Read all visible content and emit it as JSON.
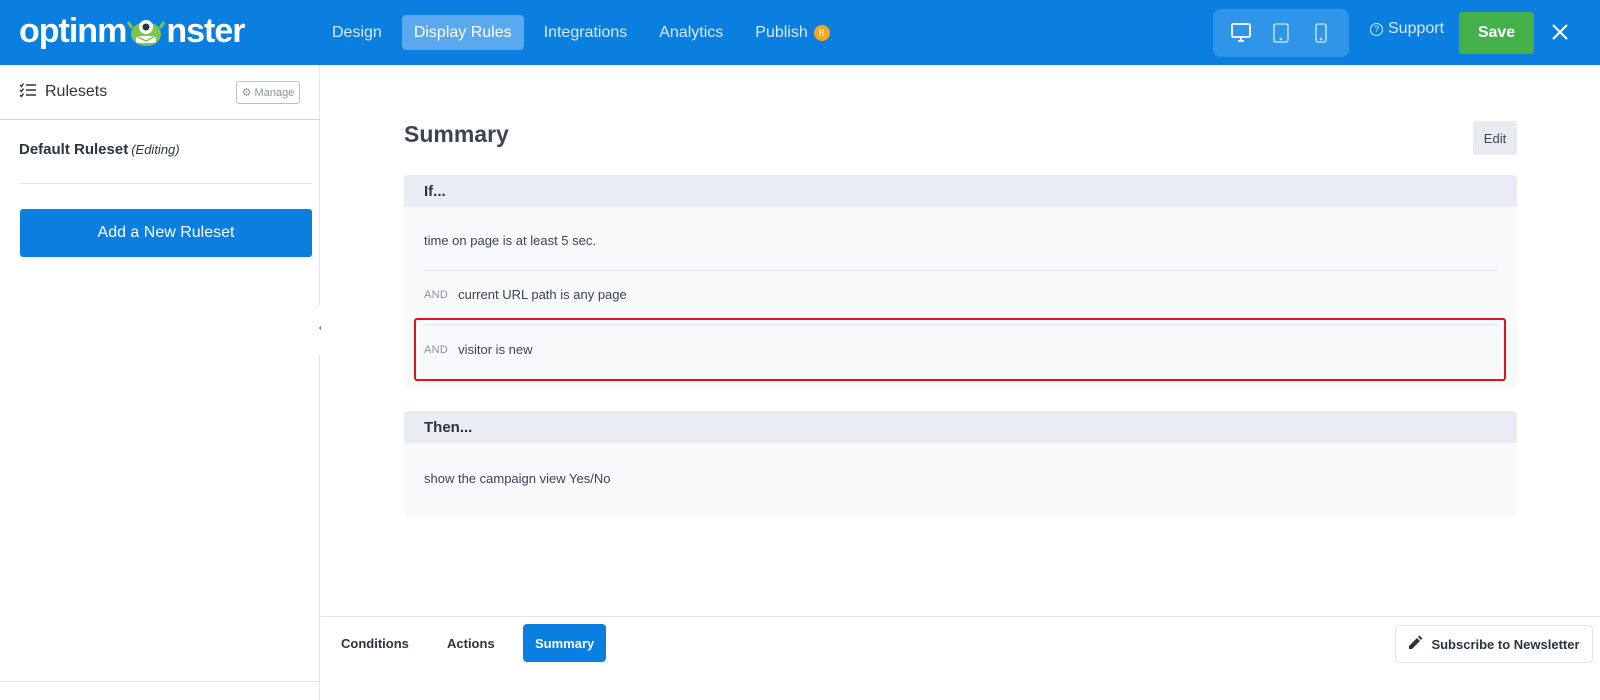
{
  "brand": {
    "logo_prefix": "optinm",
    "logo_suffix": "nster",
    "primary_color": "#0a7fe0",
    "save_color": "#43b04a",
    "highlight_color": "#e3101e"
  },
  "nav": {
    "items": [
      {
        "label": "Design"
      },
      {
        "label": "Display Rules"
      },
      {
        "label": "Integrations"
      },
      {
        "label": "Analytics"
      },
      {
        "label": "Publish"
      }
    ],
    "publish_badge": "!!",
    "active": "Display Rules"
  },
  "devices": [
    "desktop-icon",
    "tablet-icon",
    "mobile-icon"
  ],
  "support_label": "Support",
  "save_label": "Save",
  "sidebar": {
    "title": "Rulesets",
    "manage_label": "Manage",
    "default_ruleset": "Default Ruleset",
    "editing_note": "(Editing)",
    "add_label": "Add a New Ruleset"
  },
  "summary": {
    "title": "Summary",
    "edit_label": "Edit",
    "if_header": "If...",
    "conditions": [
      {
        "prefix": "",
        "text": "time on page is at least 5 sec."
      },
      {
        "prefix": "AND",
        "text": "current URL path is any page"
      },
      {
        "prefix": "AND",
        "text": "visitor is new"
      }
    ],
    "then_header": "Then...",
    "action": "show the campaign view Yes/No"
  },
  "bottom_tabs": [
    {
      "label": "Conditions"
    },
    {
      "label": "Actions"
    },
    {
      "label": "Summary"
    }
  ],
  "active_tab": "Summary",
  "newsletter_label": "Subscribe to Newsletter"
}
